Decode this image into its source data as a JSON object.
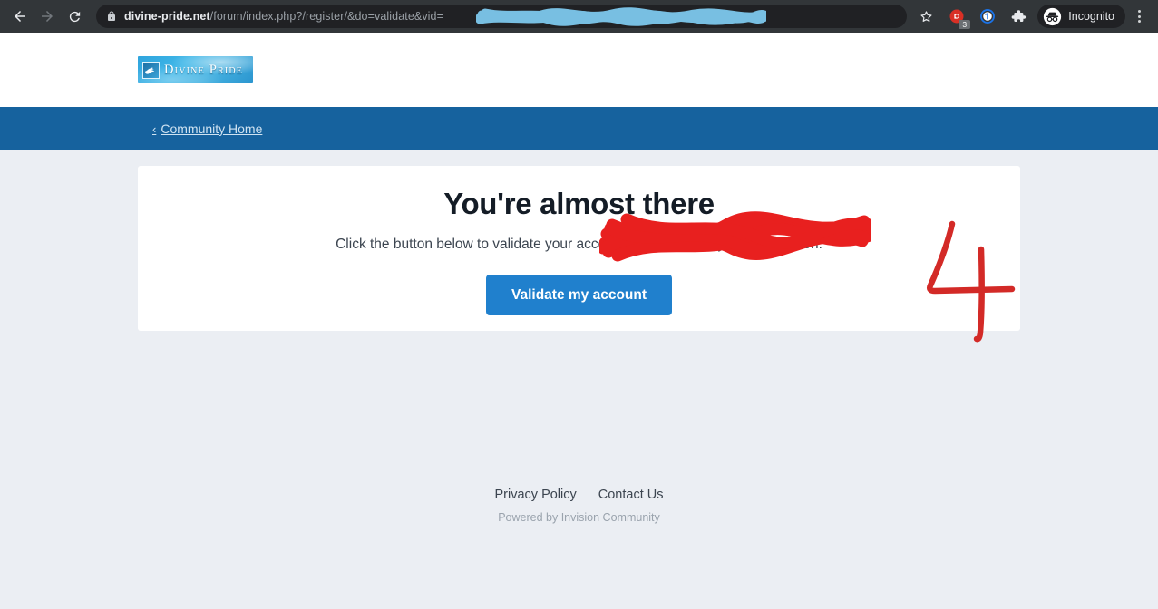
{
  "browser": {
    "back_label": "Back",
    "forward_label": "Forward",
    "reload_label": "Reload",
    "url": {
      "host": "divine-pride.net",
      "path": "/forum/index.php?/register/&do=validate&vid=",
      "redacted_value": "[redacted]",
      "lock_icon": "lock-icon"
    },
    "bookmark_label": "Bookmark this tab",
    "extensions": [
      {
        "name": "adblock-extension",
        "badge": "3"
      },
      {
        "name": "password-manager-extension",
        "badge": ""
      }
    ],
    "extensions_puzzle_label": "Extensions",
    "profile": {
      "label": "Incognito",
      "icon": "incognito-icon"
    },
    "menu_label": "Customize and control Google Chrome"
  },
  "site": {
    "logo_text": "Divine Pride",
    "logo_mark": "eagle-icon"
  },
  "nav": {
    "back_link": "Community Home",
    "chevron": "‹"
  },
  "card": {
    "title": "You're almost there",
    "title_redaction": "red-scribble-redaction",
    "subtitle": "Click the button below to validate your account and complete your registration.",
    "button_label": "Validate my account"
  },
  "annotation": {
    "step_number": "4",
    "color": "#d32a27"
  },
  "footer": {
    "links": [
      {
        "label": "Privacy Policy"
      },
      {
        "label": "Contact Us"
      }
    ],
    "credit": "Powered by Invision Community"
  },
  "colors": {
    "page_bg": "#ebeef3",
    "nav_blue": "#16629e",
    "button_blue": "#2080cd",
    "chrome_bg": "#323639",
    "omnibox_bg": "#202124",
    "url_redaction": "#7ec9ee",
    "title_redaction": "#e8201f"
  }
}
